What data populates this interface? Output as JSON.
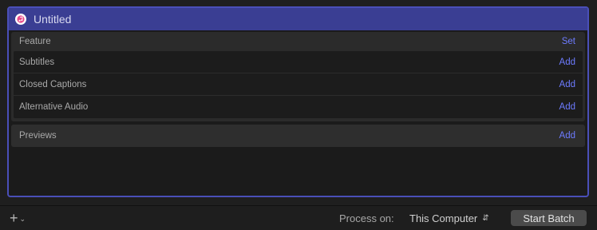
{
  "batch": {
    "title": "Untitled",
    "icon": "itunes-icon"
  },
  "feature": {
    "label": "Feature",
    "action": "Set",
    "rows": [
      {
        "label": "Subtitles",
        "action": "Add"
      },
      {
        "label": "Closed Captions",
        "action": "Add"
      },
      {
        "label": "Alternative Audio",
        "action": "Add"
      }
    ]
  },
  "previews": {
    "label": "Previews",
    "action": "Add"
  },
  "toolbar": {
    "add_icon": "plus-icon",
    "process_label": "Process on:",
    "process_value": "This Computer",
    "start_label": "Start Batch"
  },
  "colors": {
    "accent": "#4a4fb8",
    "header": "#3a3e93",
    "link": "#6d7bff"
  }
}
